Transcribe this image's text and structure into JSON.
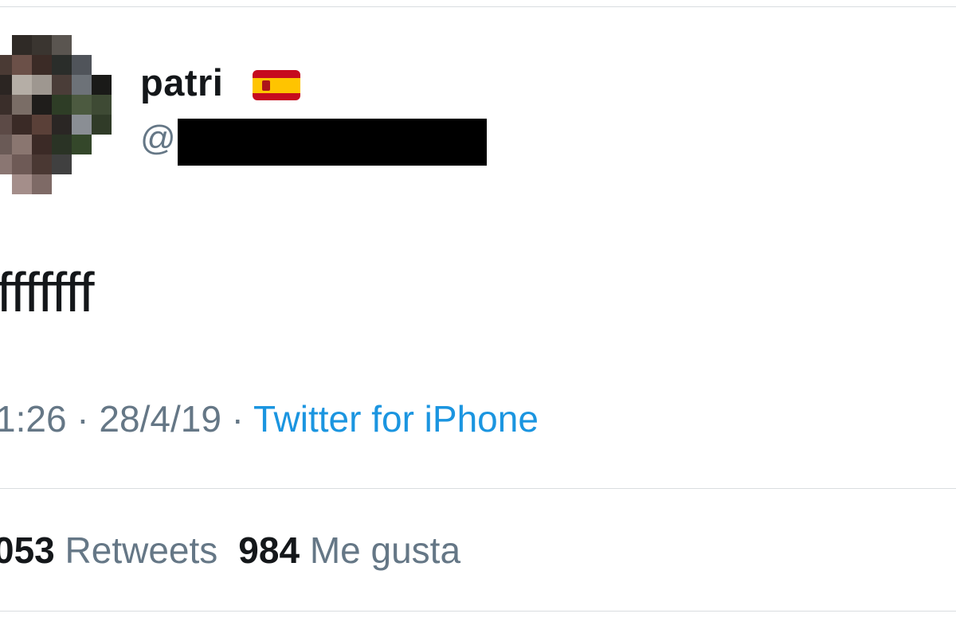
{
  "tweet": {
    "author": {
      "display_name": "patri",
      "flag_emoji": "spain-flag-icon",
      "handle_prefix": "@"
    },
    "text": "fffffff",
    "meta": {
      "time": "1:26",
      "separator": " · ",
      "date": "28/4/19",
      "source": "Twitter for iPhone"
    },
    "stats": {
      "retweets_count": "053",
      "retweets_label": "Retweets",
      "likes_count": "984",
      "likes_label": "Me gusta"
    }
  },
  "colors": {
    "text_primary": "#14171a",
    "text_secondary": "#657786",
    "link": "#1b95e0",
    "divider": "#d9dde0",
    "redaction": "#000000"
  },
  "avatar_pixels": [
    "#ffffff",
    "#2f2a26",
    "#3a3530",
    "#5a5550",
    "#ffffff",
    "#ffffff",
    "#4a3a34",
    "#6b5048",
    "#3b2b26",
    "#2a2d2a",
    "#50545a",
    "#ffffff",
    "#2b2522",
    "#b5aea6",
    "#9e9790",
    "#4a3d38",
    "#6d7278",
    "#1a1a18",
    "#3a2e2a",
    "#7a6d66",
    "#1f1d1b",
    "#2e3d26",
    "#4c5a40",
    "#3e4a34",
    "#5c4a46",
    "#3a2a26",
    "#5a4038",
    "#2a2624",
    "#8a8e94",
    "#303b28",
    "#6a5a56",
    "#8a7670",
    "#3b2a26",
    "#2a3325",
    "#34472a",
    "#ffffff",
    "#8a7672",
    "#6e5a56",
    "#4a3833",
    "#404040",
    "#ffffff",
    "#ffffff",
    "#ffffff",
    "#a48e8a",
    "#7e6a66",
    "#ffffff",
    "#ffffff",
    "#ffffff"
  ]
}
